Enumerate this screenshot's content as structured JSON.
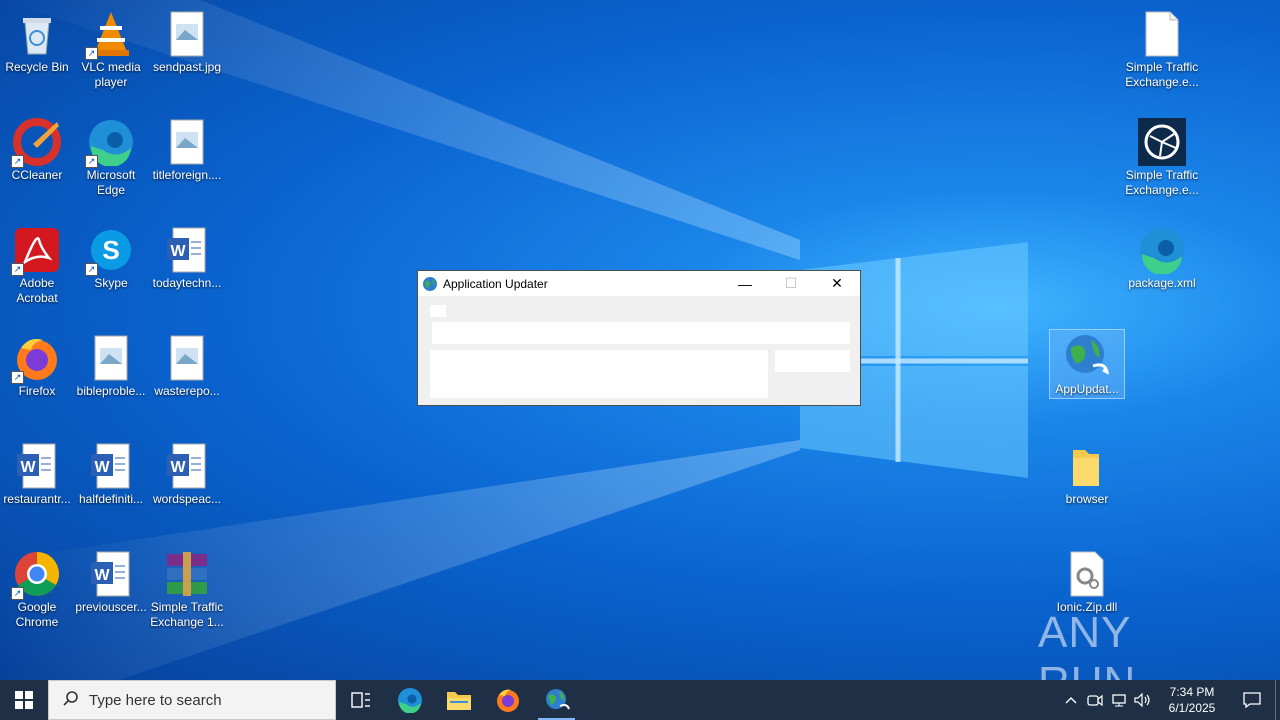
{
  "desktop": {
    "icons_left": [
      {
        "label": "Recycle Bin",
        "icon": "recycle-bin-icon"
      },
      {
        "label": "VLC media player",
        "icon": "vlc-icon"
      },
      {
        "label": "sendpast.jpg",
        "icon": "image-file-icon"
      },
      {
        "label": "CCleaner",
        "icon": "ccleaner-icon"
      },
      {
        "label": "Microsoft Edge",
        "icon": "edge-icon"
      },
      {
        "label": "titleforeign....",
        "icon": "image-file-icon"
      },
      {
        "label": "Adobe Acrobat",
        "icon": "acrobat-icon"
      },
      {
        "label": "Skype",
        "icon": "skype-icon"
      },
      {
        "label": "todaytechn...",
        "icon": "word-doc-icon"
      },
      {
        "label": "Firefox",
        "icon": "firefox-icon"
      },
      {
        "label": "bibleproble...",
        "icon": "image-file-icon"
      },
      {
        "label": "wasterepo...",
        "icon": "image-file-icon"
      },
      {
        "label": "restaurantr...",
        "icon": "word-doc-icon"
      },
      {
        "label": "halfdefiniti...",
        "icon": "word-doc-icon"
      },
      {
        "label": "wordspeac...",
        "icon": "word-doc-icon"
      },
      {
        "label": "Google Chrome",
        "icon": "chrome-icon"
      },
      {
        "label": "previouscer...",
        "icon": "word-doc-icon"
      },
      {
        "label": "Simple Traffic Exchange 1...",
        "icon": "winrar-icon"
      }
    ],
    "icons_right": [
      {
        "label": "Simple Traffic Exchange.e...",
        "icon": "blank-file-icon"
      },
      {
        "label": "Simple Traffic Exchange.e...",
        "icon": "network-app-icon"
      },
      {
        "label": "package.xml",
        "icon": "edge-icon"
      },
      {
        "label": "AppUpdat...",
        "icon": "globe-updater-icon"
      },
      {
        "label": "browser",
        "icon": "folder-icon"
      },
      {
        "label": "Ionic.Zip.dll",
        "icon": "dll-file-icon"
      }
    ],
    "watermark": "ANY RUN"
  },
  "window": {
    "title": "Application Updater",
    "minimize": "—",
    "maximize": "☐",
    "close": "✕"
  },
  "taskbar": {
    "search_placeholder": "Type here to search",
    "apps": [
      "task-view-icon",
      "edge-icon",
      "file-explorer-icon",
      "firefox-icon",
      "globe-updater-icon"
    ],
    "time": "7:34 PM",
    "date": "6/1/2025"
  },
  "colors": {
    "taskbar": "#1f2f46",
    "desktop_accent": "#1b86ea"
  }
}
